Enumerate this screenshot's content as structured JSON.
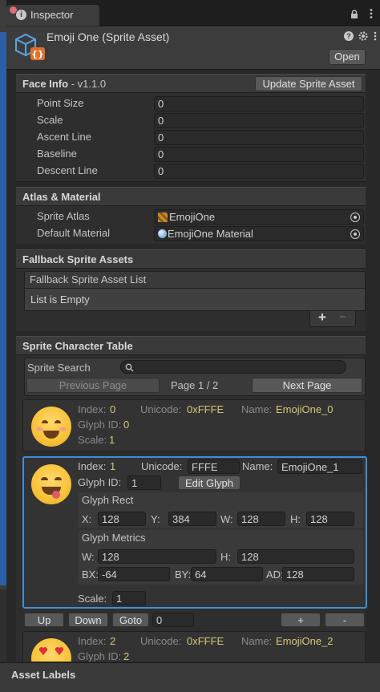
{
  "tab": {
    "label": "Inspector"
  },
  "asset": {
    "title": "Emoji One (Sprite Asset)",
    "open_label": "Open"
  },
  "face_info": {
    "header": "Face Info",
    "version": "- v1.1.0",
    "update_label": "Update Sprite Asset",
    "fields": [
      {
        "label": "Point Size",
        "value": "0"
      },
      {
        "label": "Scale",
        "value": "0"
      },
      {
        "label": "Ascent Line",
        "value": "0"
      },
      {
        "label": "Baseline",
        "value": "0"
      },
      {
        "label": "Descent Line",
        "value": "0"
      }
    ]
  },
  "atlas": {
    "header": "Atlas & Material",
    "sprite_atlas_label": "Sprite Atlas",
    "sprite_atlas_value": "EmojiOne",
    "default_material_label": "Default Material",
    "default_material_value": "EmojiOne Material"
  },
  "fallback": {
    "header": "Fallback Sprite Assets",
    "list_title": "Fallback Sprite Asset List",
    "empty_text": "List is Empty",
    "add_symbol": "+",
    "remove_symbol": "−"
  },
  "table": {
    "header": "Sprite Character Table",
    "search_label": "Sprite Search",
    "search_value": "",
    "prev_page": "Previous Page",
    "page_info": "Page 1 / 2",
    "next_page": "Next Page"
  },
  "entries": [
    {
      "index_label": "Index:",
      "index": "0",
      "unicode_label": "Unicode:",
      "unicode": "0xFFFE",
      "name_label": "Name:",
      "name": "EmojiOne_0",
      "glyph_label": "Glyph ID:",
      "glyph": "0",
      "scale_label": "Scale:",
      "scale": "1"
    },
    {
      "index_label": "Index:",
      "index": "1",
      "unicode_label": "Unicode:",
      "unicode": "FFFE",
      "name_label": "Name:",
      "name": "EmojiOne_1",
      "glyph_label": "Glyph ID:",
      "glyph": "1",
      "edit_glyph": "Edit Glyph",
      "glyph_rect_label": "Glyph Rect",
      "rect": {
        "x_label": "X:",
        "x": "128",
        "y_label": "Y:",
        "y": "384",
        "w_label": "W:",
        "w": "128",
        "h_label": "H:",
        "h": "128"
      },
      "glyph_metrics_label": "Glyph Metrics",
      "metrics": {
        "w_label": "W:",
        "w": "128",
        "h_label": "H:",
        "h": "128",
        "bx_label": "BX:",
        "bx": "-64",
        "by_label": "BY:",
        "by": "64",
        "ad_label": "AD:",
        "ad": "128"
      },
      "scale_label": "Scale:",
      "scale": "1"
    },
    {
      "index_label": "Index:",
      "index": "2",
      "unicode_label": "Unicode:",
      "unicode": "0xFFFE",
      "name_label": "Name:",
      "name": "EmojiOne_2",
      "glyph_label": "Glyph ID:",
      "glyph": "2"
    }
  ],
  "nav": {
    "up": "Up",
    "down": "Down",
    "goto": "Goto",
    "goto_value": "0",
    "add": "+",
    "remove": "-"
  },
  "footer": {
    "asset_labels": "Asset Labels"
  },
  "colors": {
    "selection": "#3d8fd6",
    "accent_text": "#d4c87a"
  }
}
